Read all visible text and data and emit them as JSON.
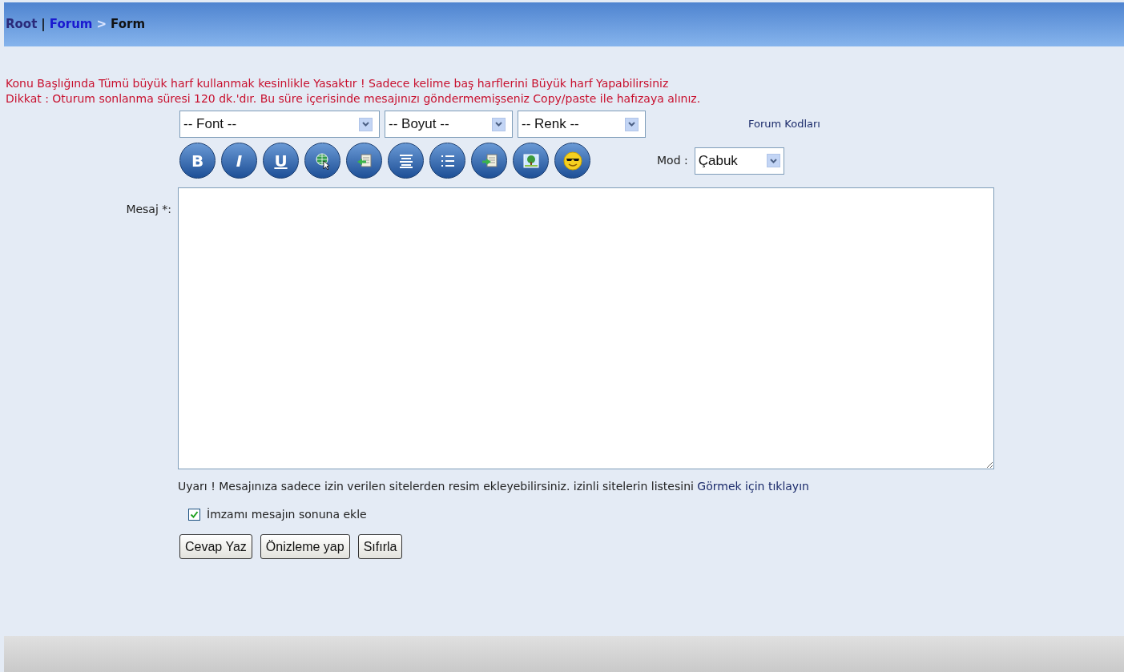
{
  "breadcrumb": [
    {
      "kind": "link",
      "text": "Root",
      "color": "#2a2a7a"
    },
    {
      "kind": "sep",
      "text": "|"
    },
    {
      "kind": "link",
      "text": "Forum",
      "color": "#1a1ad0"
    },
    {
      "kind": "sep",
      "text": ">"
    },
    {
      "kind": "current",
      "text": "Form"
    }
  ],
  "warnings": [
    "Konu Başlığında Tümü büyük harf kullanmak kesinlikle Yasaktır ! Sadece kelime baş harflerini Büyük harf Yapabilirsiniz",
    "Dikkat : Oturum sonlanma süresi 120 dk.'dır. Bu süre içerisinde mesajınızı göndermemişseniz Copy/paste ile hafızaya alınız."
  ],
  "selects": [
    {
      "value": "-- Font --"
    },
    {
      "value": "-- Boyut --"
    },
    {
      "value": "-- Renk --"
    }
  ],
  "forum_codes_link": "Forum Kodları",
  "toolbar": [
    {
      "kind": "bold",
      "label": "B"
    },
    {
      "kind": "italic",
      "label": "I"
    },
    {
      "kind": "underline",
      "label": "U"
    },
    {
      "kind": "globe"
    },
    {
      "kind": "insert-left"
    },
    {
      "kind": "align-center"
    },
    {
      "kind": "list"
    },
    {
      "kind": "insert-right"
    },
    {
      "kind": "image"
    },
    {
      "kind": "smiley"
    }
  ],
  "mode": {
    "label": "Mod :",
    "value": "Çabuk"
  },
  "message": {
    "label": "Mesaj *:"
  },
  "notice": {
    "text": "Uyarı ! Mesajınıza sadece izin verilen sitelerden resim ekleyebilirsiniz. izinli sitelerin listesini",
    "link": "Görmek için tıklayın"
  },
  "signature": {
    "label": "İmzamı mesajın sonuna ekle",
    "checked": true
  },
  "buttons": [
    "Cevap Yaz",
    "Önizleme yap",
    "Sıfırla"
  ]
}
